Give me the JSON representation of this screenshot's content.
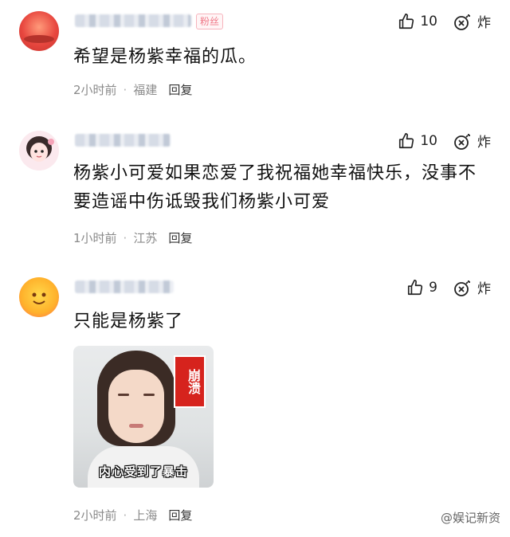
{
  "comments": [
    {
      "badge": "粉丝",
      "likes": "10",
      "dislike_label": "炸",
      "text": "希望是杨紫幸福的瓜。",
      "time": "2小时前",
      "location": "福建",
      "reply_label": "回复"
    },
    {
      "likes": "10",
      "dislike_label": "炸",
      "text": "杨紫小可爱如果恋爱了我祝福她幸福快乐，没事不要造谣中伤诋毁我们杨紫小可爱",
      "time": "1小时前",
      "location": "江苏",
      "reply_label": "回复"
    },
    {
      "likes": "9",
      "dislike_label": "炸",
      "text": "只能是杨紫了",
      "sticker": {
        "tag": "崩溃",
        "caption": "内心受到了暴击"
      },
      "time": "2小时前",
      "location": "上海",
      "reply_label": "回复"
    }
  ],
  "watermark": "@娱记新资"
}
